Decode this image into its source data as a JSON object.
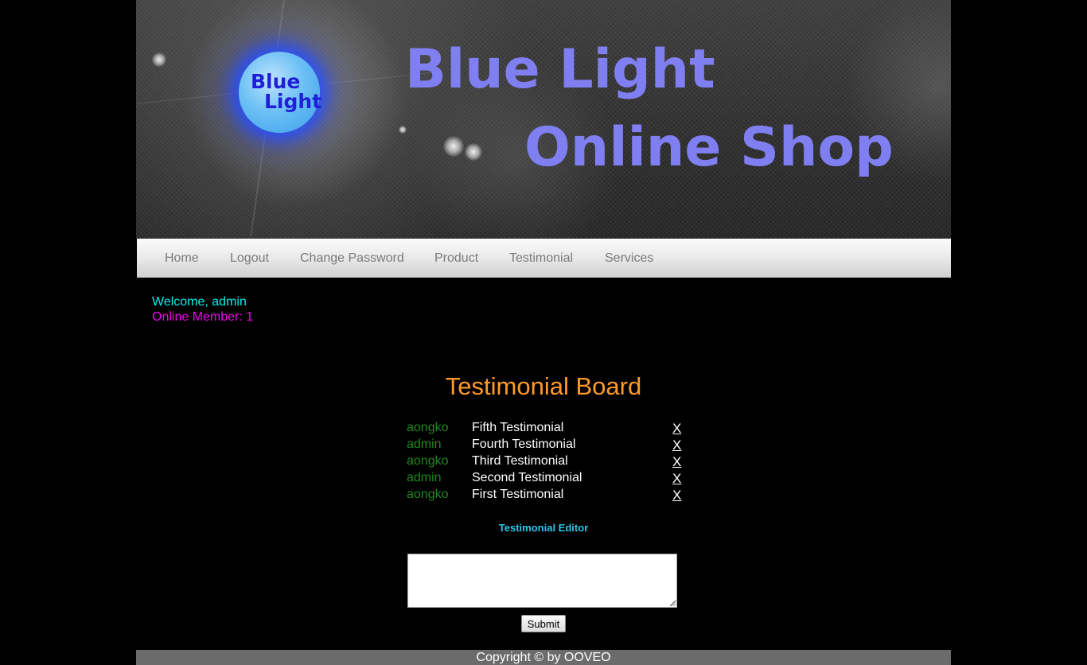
{
  "banner": {
    "logo_line1": "Blue",
    "logo_line2": "Light",
    "title_line1": "Blue Light",
    "title_line2": "Online Shop"
  },
  "nav": {
    "items": [
      {
        "label": "Home"
      },
      {
        "label": "Logout"
      },
      {
        "label": "Change Password"
      },
      {
        "label": "Product"
      },
      {
        "label": "Testimonial"
      },
      {
        "label": "Services"
      }
    ]
  },
  "status": {
    "welcome": "Welcome, admin",
    "online": "Online Member: 1"
  },
  "board": {
    "title": "Testimonial Board",
    "rows": [
      {
        "user": "aongko",
        "message": "Fifth Testimonial",
        "delete": "X"
      },
      {
        "user": "admin",
        "message": "Fourth Testimonial",
        "delete": "X"
      },
      {
        "user": "aongko",
        "message": "Third Testimonial",
        "delete": "X"
      },
      {
        "user": "admin",
        "message": "Second Testimonial",
        "delete": "X"
      },
      {
        "user": "aongko",
        "message": "First Testimonial",
        "delete": "X"
      }
    ]
  },
  "editor": {
    "label": "Testimonial Editor",
    "value": "",
    "submit_label": "Submit"
  },
  "footer": {
    "text": "Copyright © by OOVEO"
  },
  "colors": {
    "background": "#000000",
    "title_purple": "#7f7ff2",
    "logo_blue": "#1f1fd8",
    "board_title": "#ff9a2a",
    "welcome": "#00f0f0",
    "online": "#f000f0",
    "username": "#1f8a1f",
    "editor_label": "#28c8e8"
  }
}
